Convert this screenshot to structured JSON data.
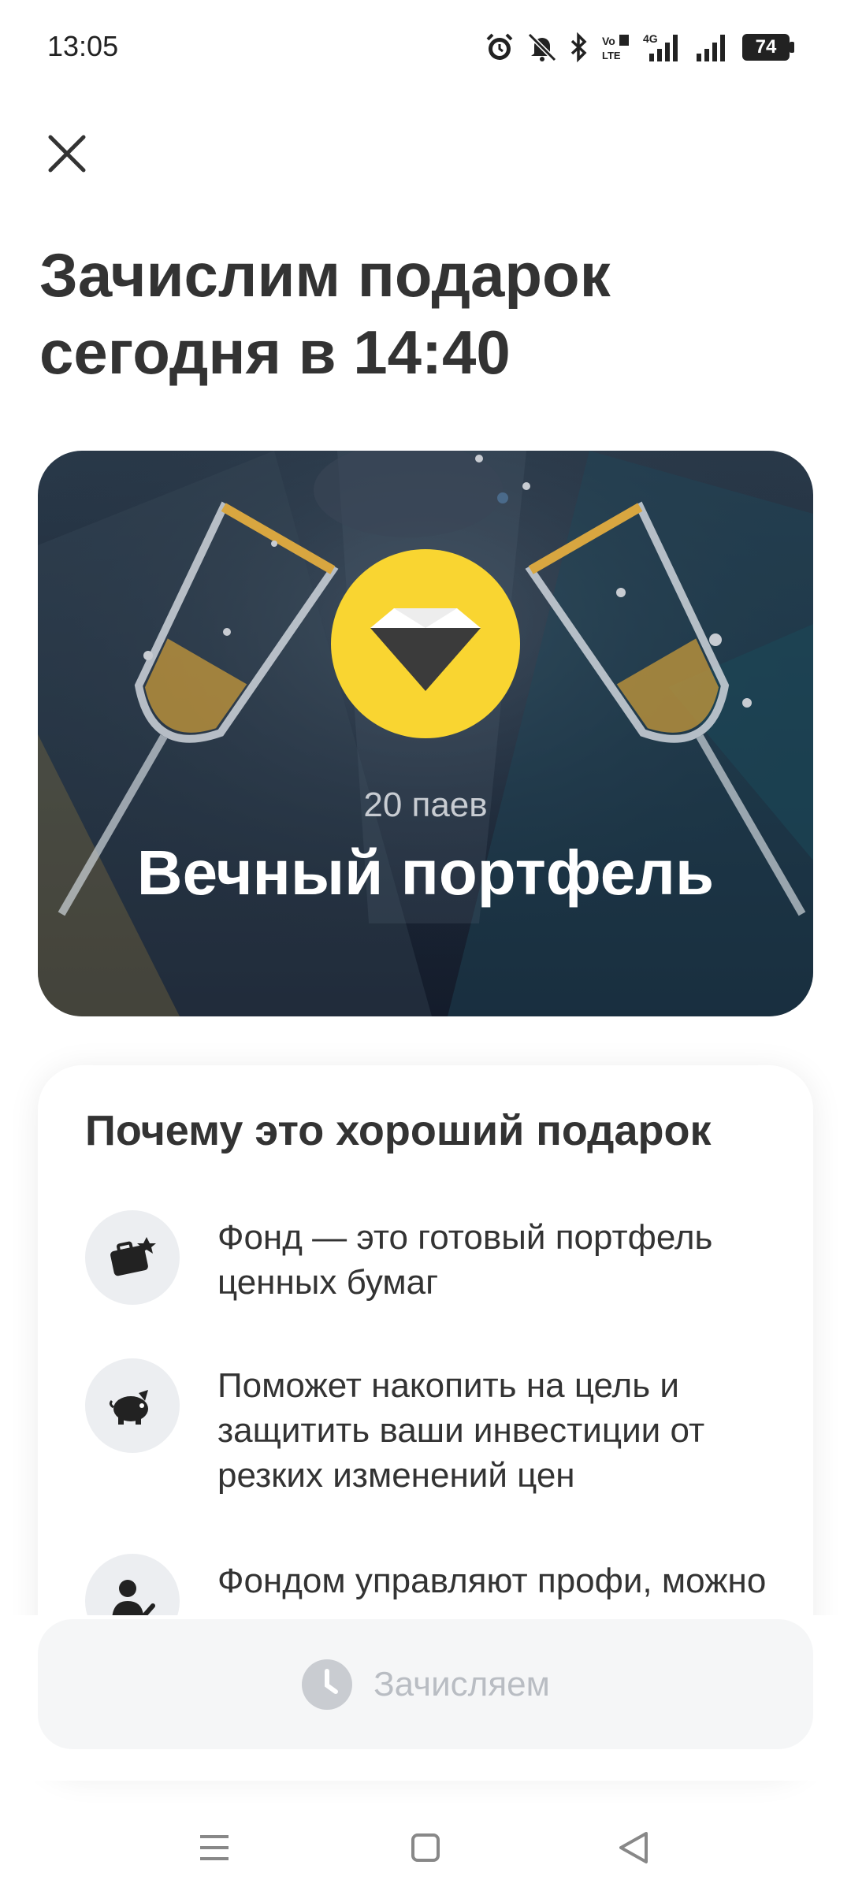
{
  "status_bar": {
    "time": "13:05",
    "battery": "74",
    "icons": [
      "alarm-icon",
      "mute-icon",
      "bluetooth-icon",
      "volte-icon",
      "signal-4g-icon",
      "signal-icon",
      "battery-icon"
    ]
  },
  "header": {
    "close_icon": "close-icon",
    "title": "Зачислим подарок сегодня в 14:40"
  },
  "gift": {
    "units": "20 паев",
    "name": "Вечный портфель",
    "badge_icon": "diamond-icon",
    "colors": {
      "badge": "#f9d531",
      "background": "#1d2a3a"
    }
  },
  "info": {
    "title": "Почему это хороший подарок",
    "items": [
      {
        "icon": "briefcase-icon",
        "text": "Фонд — это готовый портфель ценных бумаг"
      },
      {
        "icon": "piggy-bank-icon",
        "text": "Поможет накопить на цель и защитить ваши инвестиции от резких изменений цен"
      },
      {
        "icon": "manager-icon",
        "text": "Фондом управляют профи, можно не тратить время"
      }
    ]
  },
  "action": {
    "label": "Зачисляем",
    "icon": "clock-icon"
  },
  "nav": {
    "icons": [
      "menu-icon",
      "home-icon",
      "back-icon"
    ]
  }
}
